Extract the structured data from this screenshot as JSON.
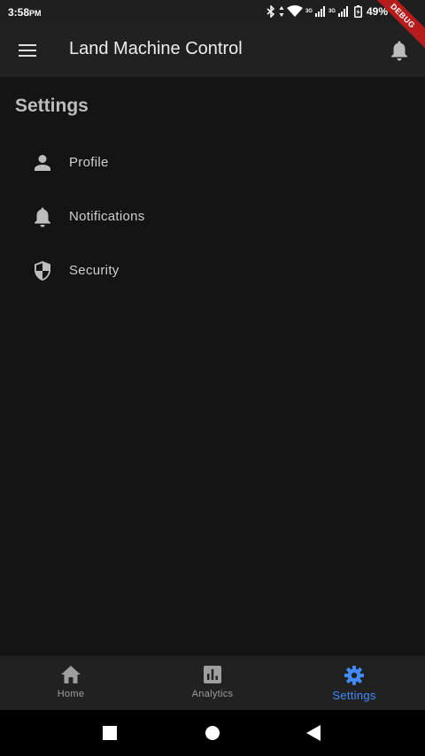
{
  "status_bar": {
    "time": "3:58",
    "ampm": "PM",
    "network_1": "3G",
    "network_2": "3G",
    "battery": "49%"
  },
  "debug_banner": "DEBUG",
  "app_bar": {
    "title": "Land Machine Control",
    "menu_icon": "menu-icon",
    "notifications_icon": "bell-icon"
  },
  "page": {
    "title": "Settings"
  },
  "settings": {
    "items": [
      {
        "label": "Profile",
        "icon": "person-icon"
      },
      {
        "label": "Notifications",
        "icon": "bell-icon"
      },
      {
        "label": "Security",
        "icon": "shield-icon"
      }
    ]
  },
  "bottom_nav": {
    "items": [
      {
        "label": "Home",
        "icon": "home-icon",
        "active": false
      },
      {
        "label": "Analytics",
        "icon": "analytics-icon",
        "active": false
      },
      {
        "label": "Settings",
        "icon": "gear-icon",
        "active": true
      }
    ]
  },
  "colors": {
    "background": "#141414",
    "app_bar": "#212121",
    "accent": "#448aff",
    "debug": "#b71c1c"
  }
}
